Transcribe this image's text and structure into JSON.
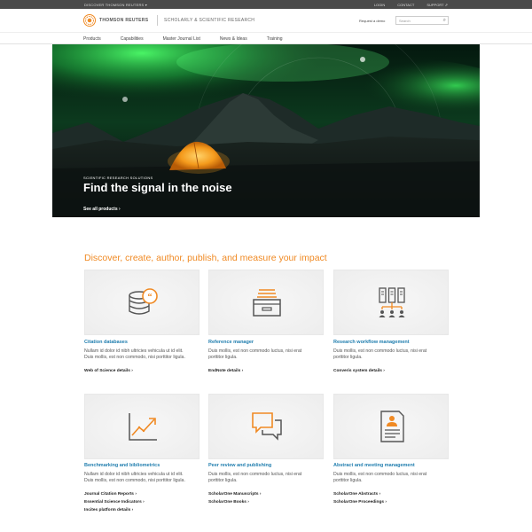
{
  "topbar": {
    "discover": "DISCOVER THOMSON REUTERS",
    "login": "LOGIN",
    "contact": "CONTACT",
    "support": "SUPPORT"
  },
  "brand": {
    "name": "THOMSON REUTERS",
    "division": "SCHOLARLY & SCIENTIFIC RESEARCH",
    "demo_label": "Request a demo",
    "search_placeholder": "Search"
  },
  "nav": {
    "items": [
      "Products",
      "Capabilities",
      "Master Journal List",
      "News & Ideas",
      "Training"
    ]
  },
  "hero": {
    "eyebrow": "SCIENTIFIC RESEARCH SOLUTIONS",
    "title": "Find the signal in the noise",
    "cta": "See all products"
  },
  "section": {
    "headline": "Discover, create, author, publish, and measure your impact"
  },
  "cards": [
    {
      "icon": "database-quote-icon",
      "title": "Citation databases",
      "desc_line1": "Nullam id dolor id nibh ultricies vehicula ut id elit.",
      "desc_line2": "Duis mollis, est non commodo, nisi porttitor ligula.",
      "links": [
        "Web of Science details"
      ]
    },
    {
      "icon": "inbox-tray-icon",
      "title": "Reference manager",
      "desc_line1": "Duis mollis, est non commodo luctus, nisi erat",
      "desc_line2": "porttitor ligula.",
      "links": [
        "EndNote details"
      ]
    },
    {
      "icon": "workflow-servers-icon",
      "title": "Research workflow management",
      "desc_line1": "Duis mollis, est non commodo luctus, nisi erat",
      "desc_line2": "porttitor ligula.",
      "links": [
        "Converis system details"
      ]
    },
    {
      "icon": "trend-chart-icon",
      "title": "Benchmarking and bibliometrics",
      "desc_line1": "Nullam id dolor id nibh ultricies vehicula ut id elit.",
      "desc_line2": "Duis mollis, est non commodo, nisi porttitor ligula.",
      "links": [
        "Journal Citation Reports",
        "Essential Science Indicators",
        "Incites platform details"
      ]
    },
    {
      "icon": "chat-bubbles-icon",
      "title": "Peer review and publishing",
      "desc_line1": "Duis mollis, est non commodo luctus, nisi erat",
      "desc_line2": "porttitor ligula.",
      "links": [
        "ScholarOne Manuscripts",
        "ScholarOne Books"
      ]
    },
    {
      "icon": "abstract-document-icon",
      "title": "Abstract and meeting management",
      "desc_line1": "Duis mollis, est non commodo luctus, nisi erat",
      "desc_line2": "porttitor ligula.",
      "links": [
        "ScholarOne Abstracts",
        "ScholarOne Proceedings"
      ]
    }
  ],
  "colors": {
    "accent": "#f08a24",
    "link_blue": "#1f7dae",
    "topbar": "#4a4a4a",
    "aurora": "#3ddc57"
  }
}
